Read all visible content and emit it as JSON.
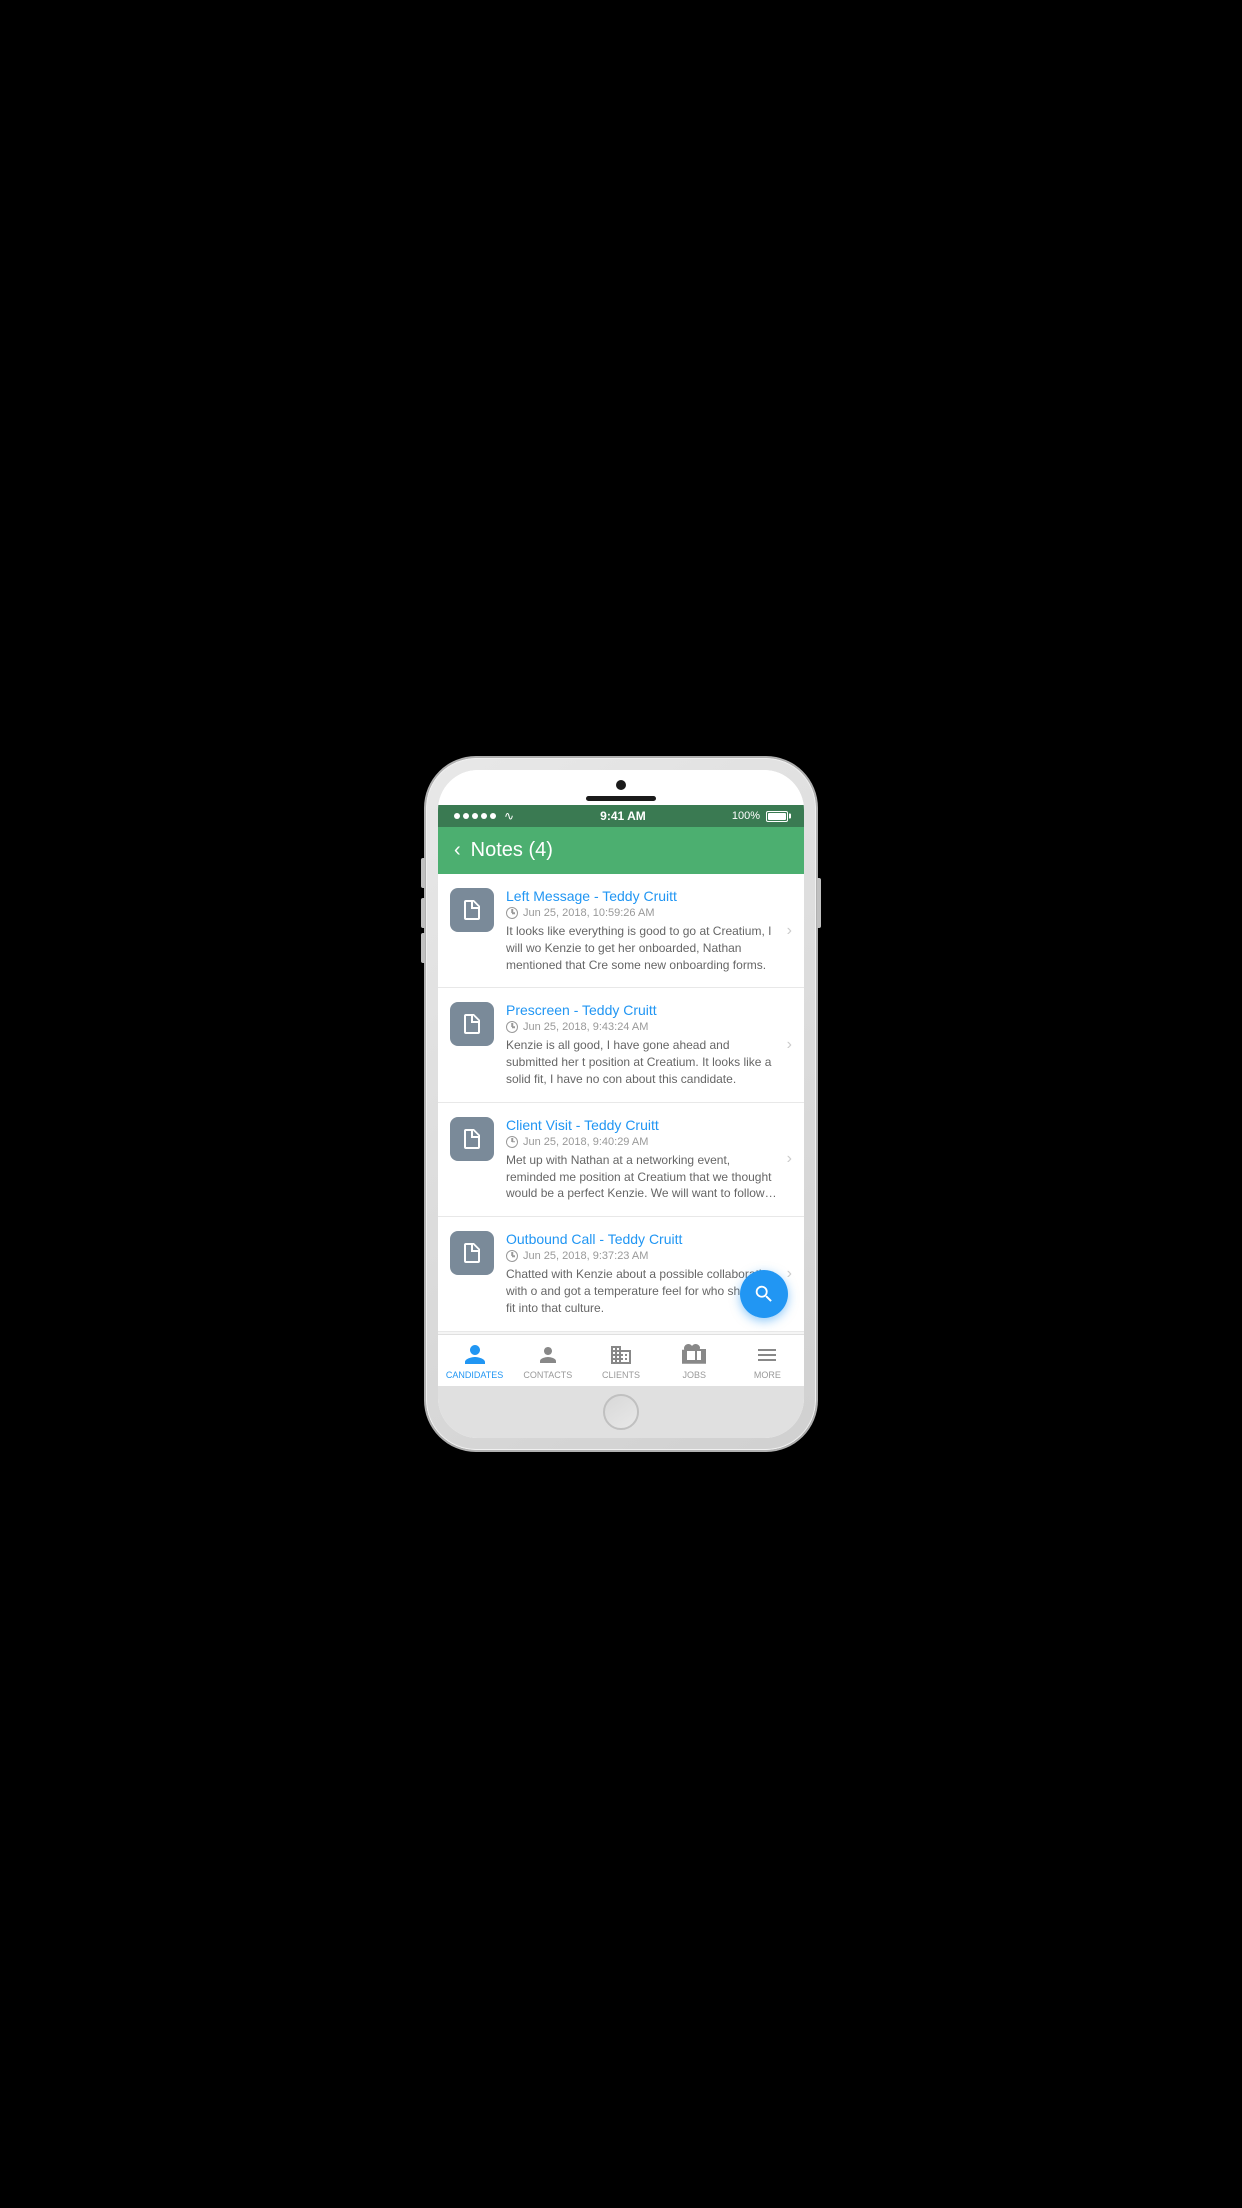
{
  "status_bar": {
    "time": "9:41 AM",
    "battery": "100%"
  },
  "header": {
    "back_label": "‹",
    "title": "Notes (4)"
  },
  "notes": [
    {
      "id": 1,
      "title": "Left Message - Teddy Cruitt",
      "date": "Jun 25, 2018, 10:59:26 AM",
      "preview": "It looks like everything is good to go at Creatium, I will wo Kenzie to get her onboarded, Nathan mentioned that Cre some new onboarding forms."
    },
    {
      "id": 2,
      "title": "Prescreen - Teddy Cruitt",
      "date": "Jun 25, 2018, 9:43:24 AM",
      "preview": "Kenzie is all good, I have gone ahead and submitted her t position at Creatium. It looks like a solid fit, I have no con about this candidate."
    },
    {
      "id": 3,
      "title": "Client Visit - Teddy Cruitt",
      "date": "Jun 25, 2018, 9:40:29 AM",
      "preview": "Met up with Nathan at a networking event, reminded me position at Creatium that we thought would be a perfect Kenzie. We will want to follow up."
    },
    {
      "id": 4,
      "title": "Outbound Call - Teddy Cruitt",
      "date": "Jun 25, 2018, 9:37:23 AM",
      "preview": "Chatted with Kenzie about a possible collaboration with o and got a temperature feel for who she might fit into that culture."
    }
  ],
  "bottom_nav": {
    "items": [
      {
        "label": "CANDIDATES",
        "active": true,
        "icon": "candidates"
      },
      {
        "label": "CONTACTS",
        "active": false,
        "icon": "contacts"
      },
      {
        "label": "CLIENTS",
        "active": false,
        "icon": "clients"
      },
      {
        "label": "JOBS",
        "active": false,
        "icon": "jobs"
      },
      {
        "label": "MORE",
        "active": false,
        "icon": "more"
      }
    ]
  }
}
